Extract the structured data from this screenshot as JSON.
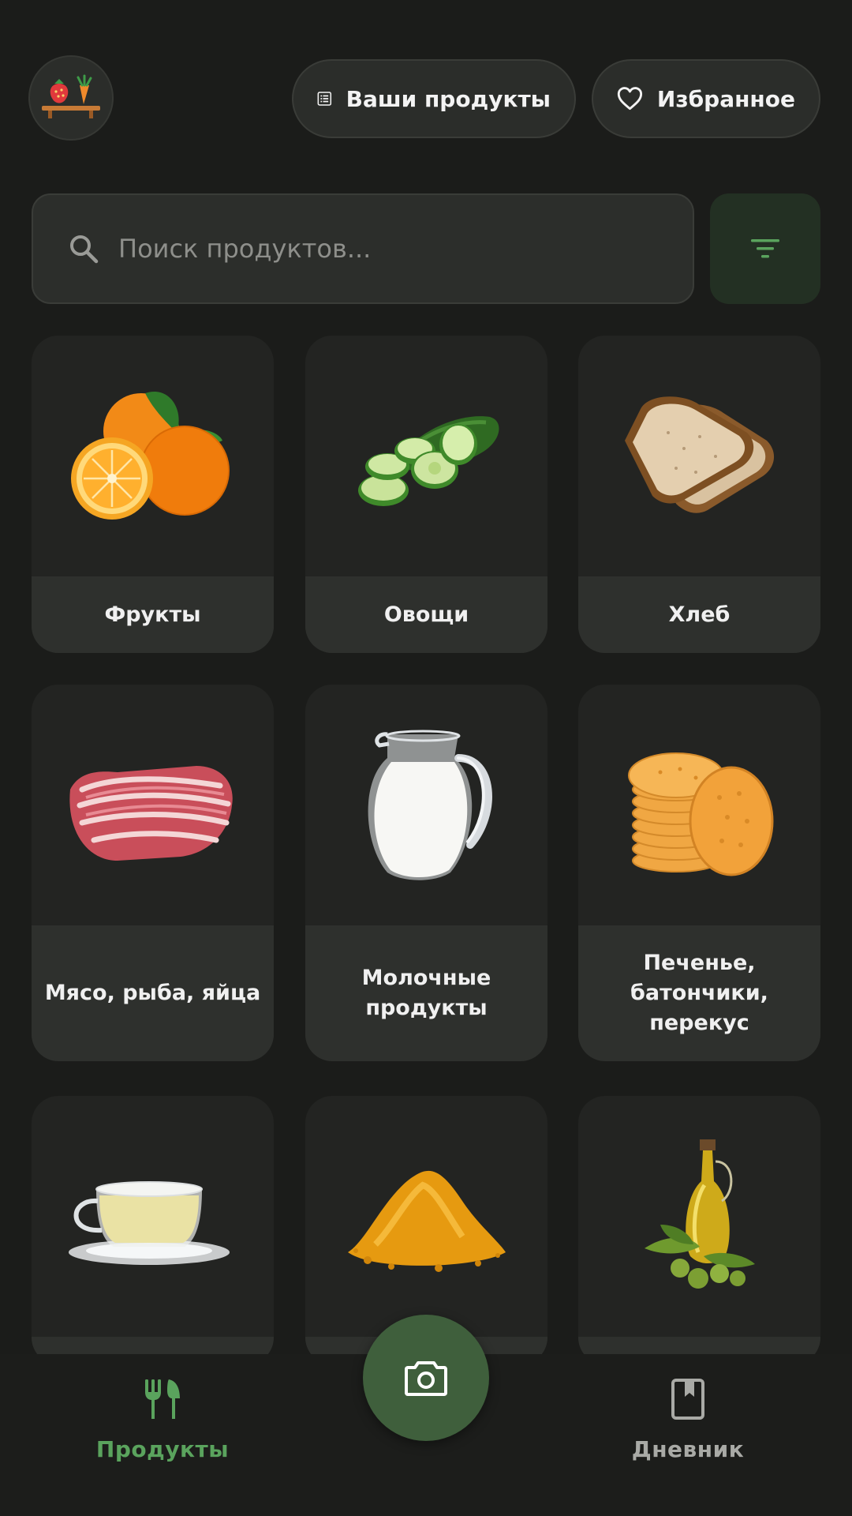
{
  "header": {
    "products_button_label": "Ваши продукты",
    "favorites_button_label": "Избранное"
  },
  "search": {
    "placeholder": "Поиск продуктов..."
  },
  "categories": [
    {
      "label": "Фрукты",
      "icon": "oranges-image"
    },
    {
      "label": "Овощи",
      "icon": "cucumber-image"
    },
    {
      "label": "Хлеб",
      "icon": "bread-image"
    },
    {
      "label": "Мясо, рыба, яйца",
      "icon": "bacon-image"
    },
    {
      "label": "Молочные\nпродукты",
      "icon": "milk-jug-image"
    },
    {
      "label": "Печенье,\nбатончики,\nперекус",
      "icon": "crackers-image"
    },
    {
      "label": "",
      "icon": "tea-cup-image"
    },
    {
      "label": "",
      "icon": "spice-powder-image"
    },
    {
      "label": "",
      "icon": "olive-oil-image"
    }
  ],
  "bottom_nav": {
    "products_label": "Продукты",
    "diary_label": "Дневник"
  },
  "colors": {
    "background": "#1b1c1a",
    "surface": "#2b2d2a",
    "accent_green": "#5aa35d",
    "fab_green": "#3f5f3c",
    "inactive_gray": "#a9aaa6"
  }
}
